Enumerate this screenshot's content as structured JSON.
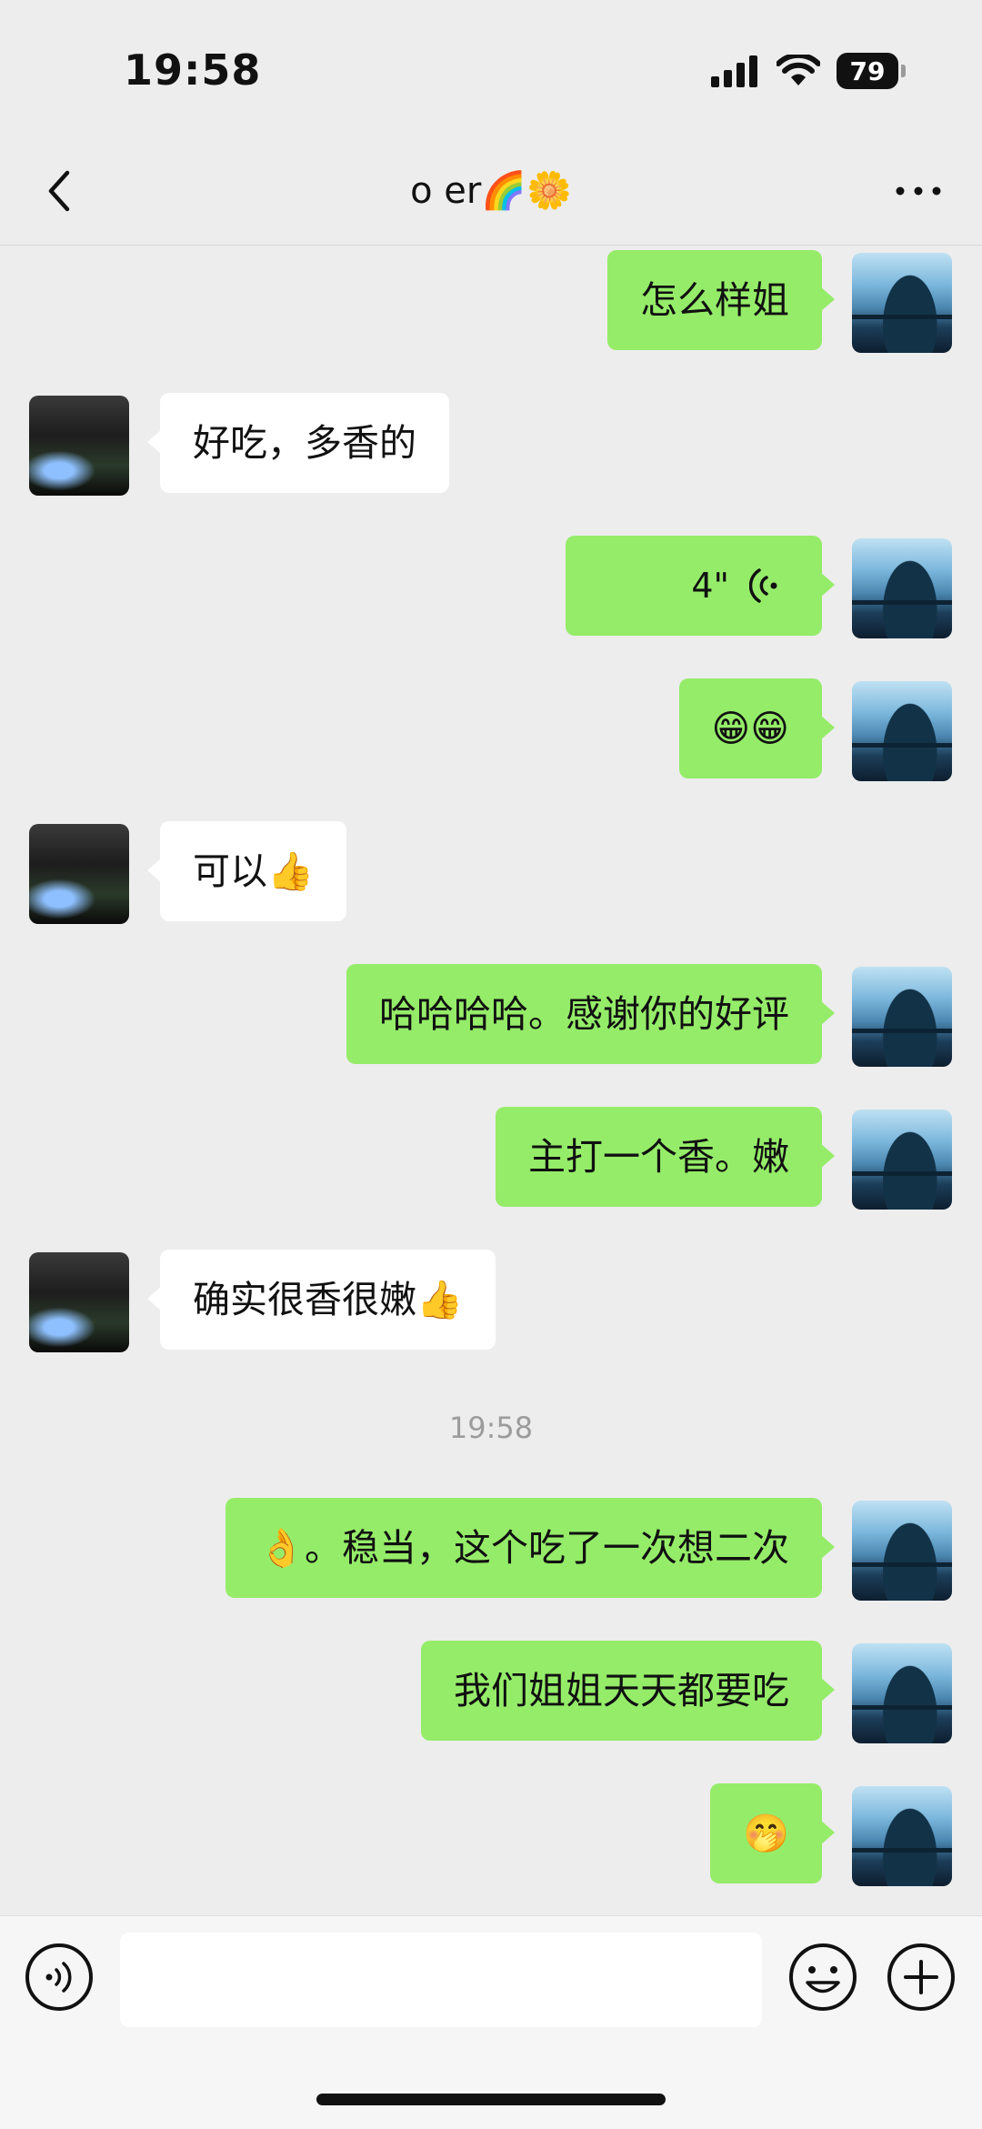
{
  "status_bar": {
    "time": "19:58",
    "battery": "79"
  },
  "header": {
    "title": "o er🌈🌼"
  },
  "messages": [
    {
      "side": "me",
      "text": "怎么样姐"
    },
    {
      "side": "other",
      "text": "好吃，多香的"
    },
    {
      "side": "me",
      "type": "voice",
      "duration": "4\""
    },
    {
      "side": "me",
      "text": "😁😁"
    },
    {
      "side": "other",
      "text": "可以👍"
    },
    {
      "side": "me",
      "text": "哈哈哈哈。感谢你的好评"
    },
    {
      "side": "me",
      "text": "主打一个香。嫩"
    },
    {
      "side": "other",
      "text": "确实很香很嫩👍"
    },
    {
      "side": "me",
      "text": "👌。稳当，这个吃了一次想二次"
    },
    {
      "side": "me",
      "text": "我们姐姐天天都要吃"
    },
    {
      "side": "me",
      "text": "🤭"
    }
  ],
  "timestamp": "19:58",
  "input": {
    "value": "",
    "placeholder": ""
  },
  "icons": {
    "back": "chevron-left-icon",
    "more": "more-dots-icon",
    "voice_toggle": "voice-icon",
    "emoji": "smiley-icon",
    "plus": "plus-icon"
  },
  "colors": {
    "my_bubble": "#95ec69",
    "other_bubble": "#ffffff",
    "background": "#ededed"
  }
}
